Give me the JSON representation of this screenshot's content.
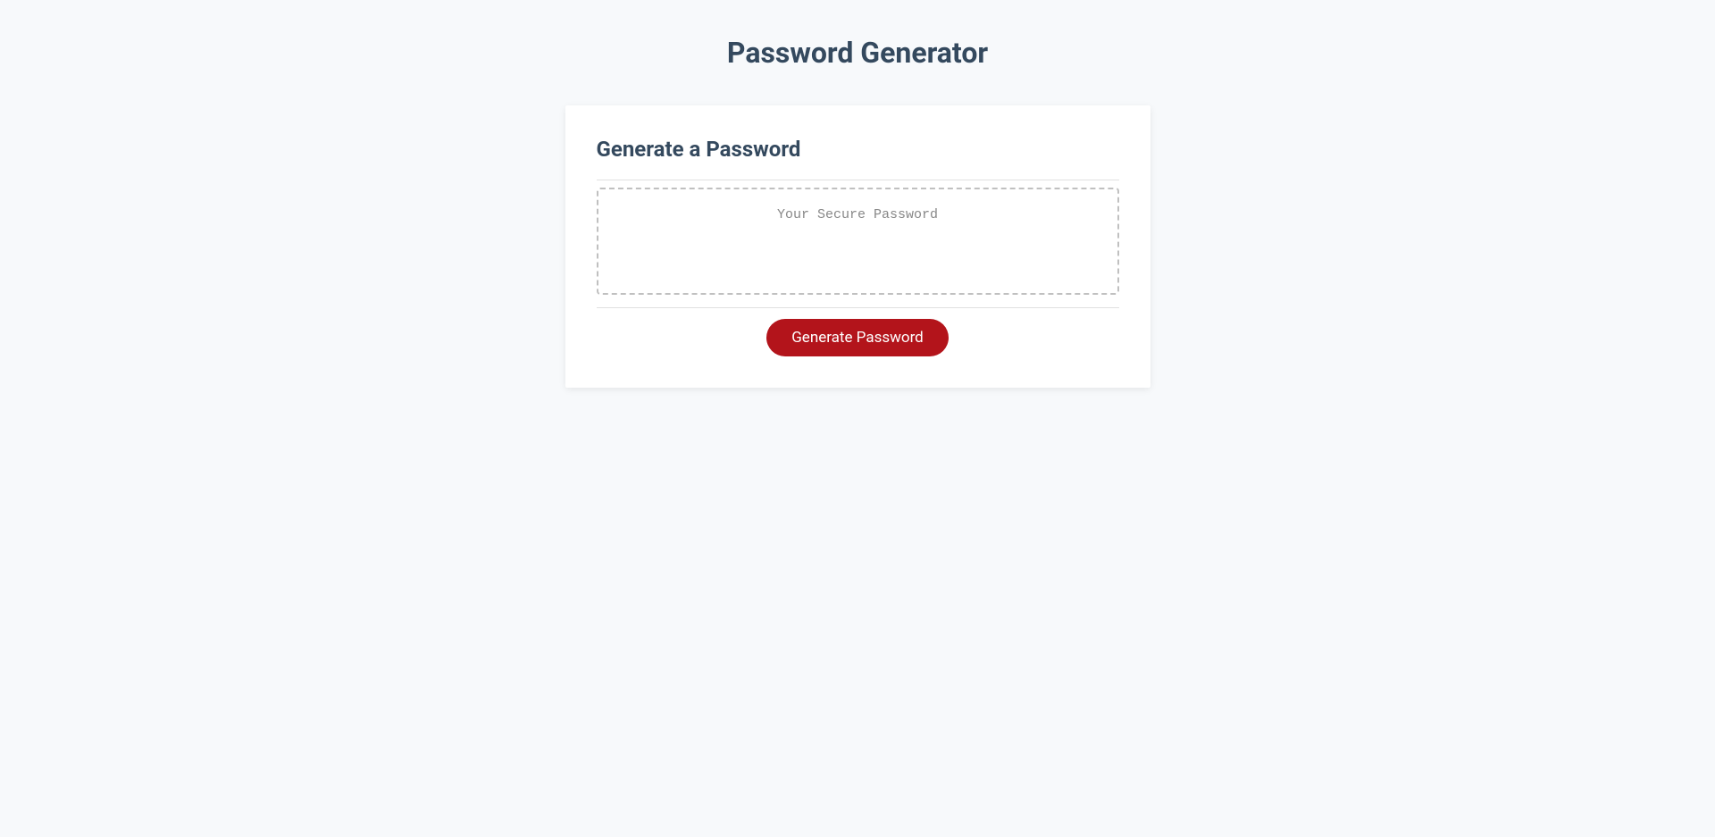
{
  "page": {
    "title": "Password Generator"
  },
  "card": {
    "title": "Generate a Password",
    "output_placeholder": "Your Secure Password",
    "output_value": "",
    "button_label": "Generate Password"
  }
}
